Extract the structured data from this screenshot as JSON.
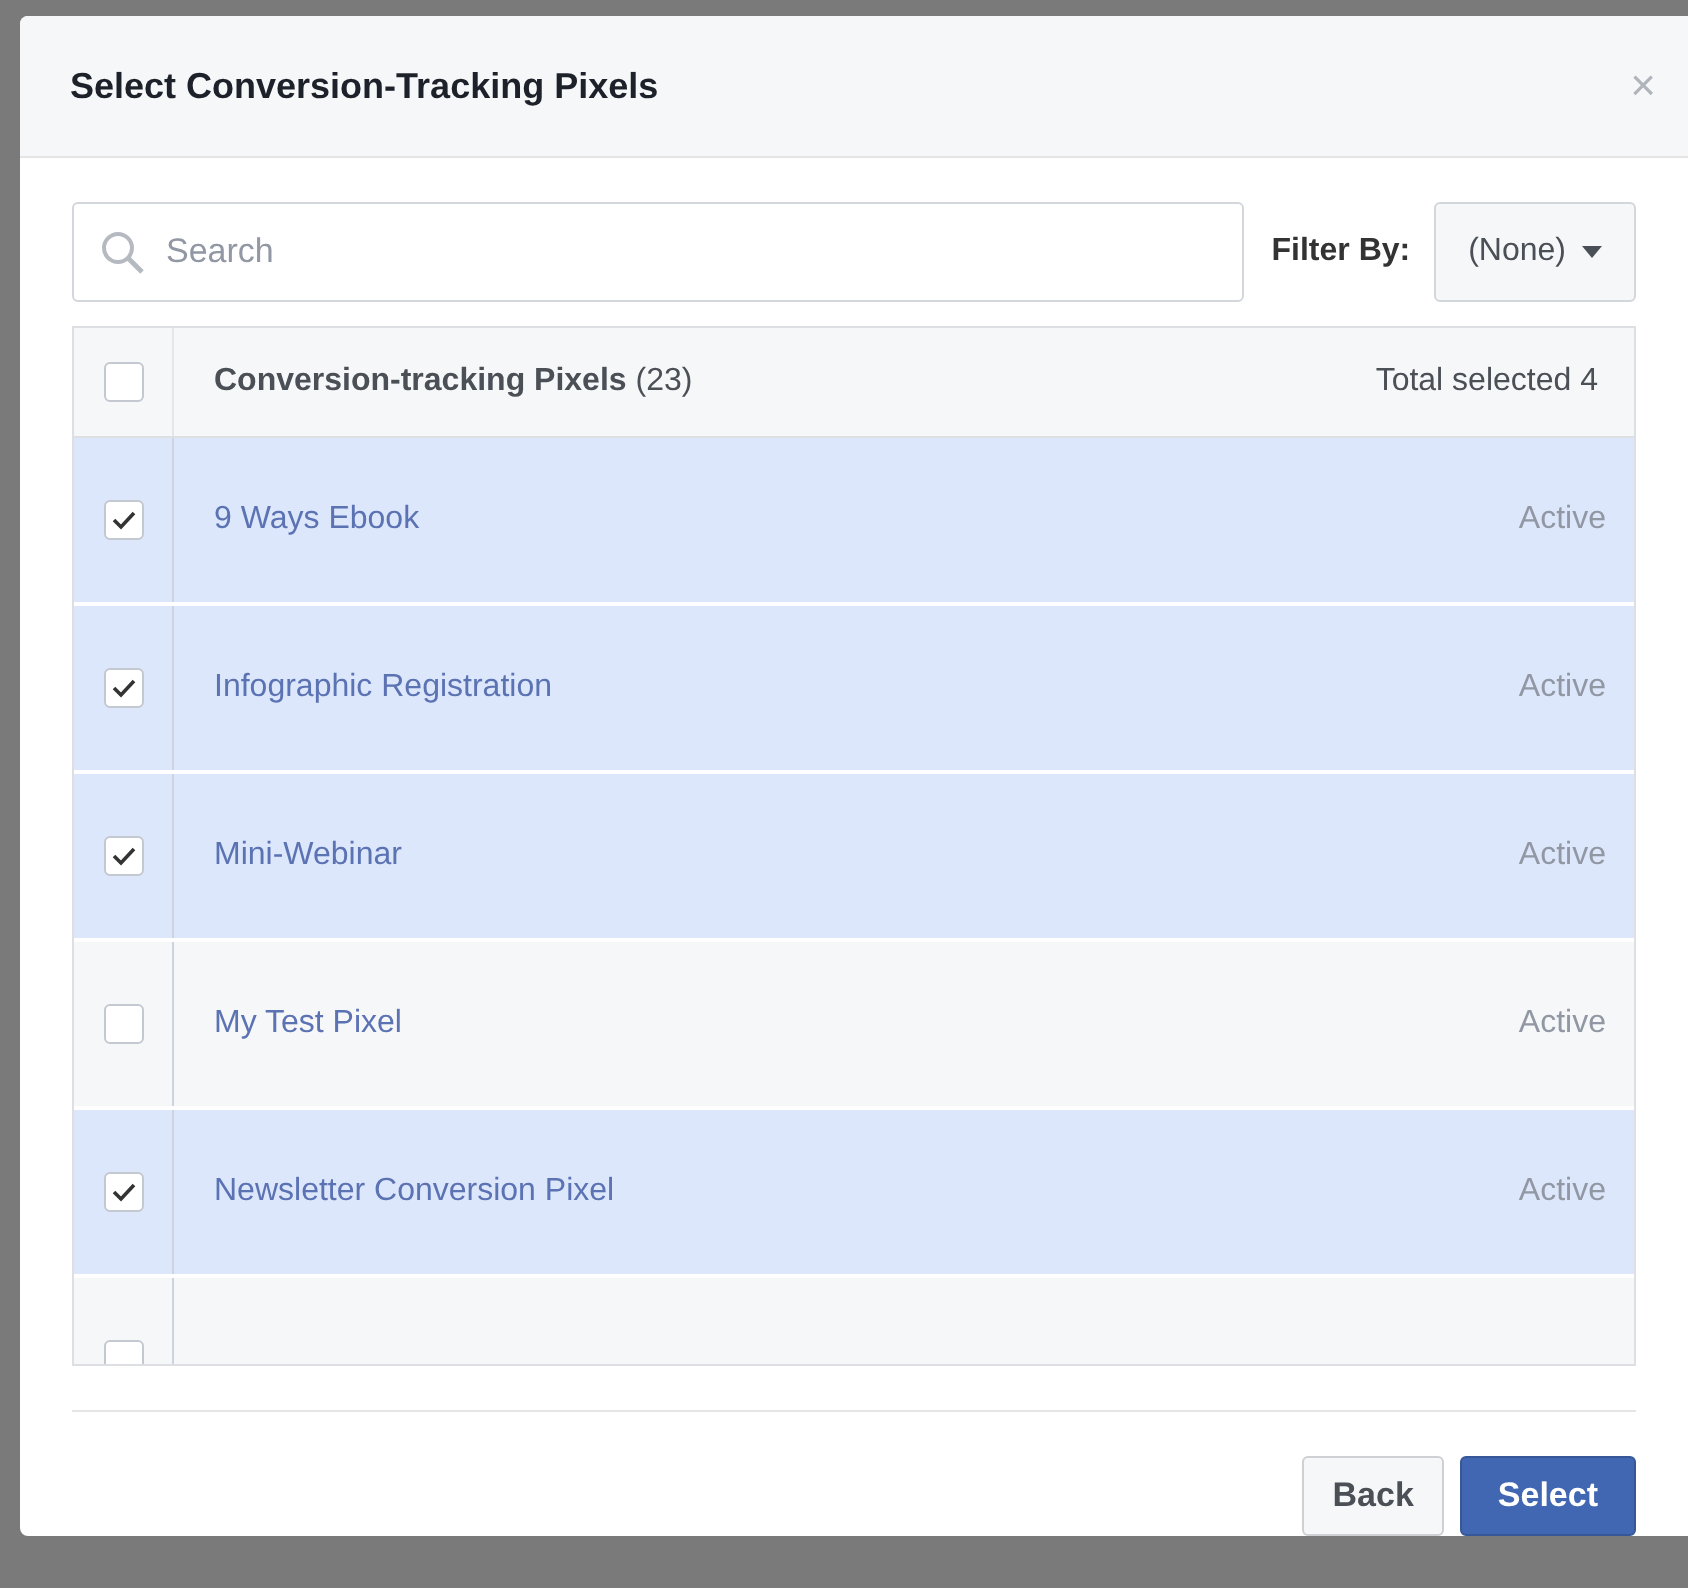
{
  "dialog": {
    "title": "Select Conversion-Tracking Pixels",
    "close": "×"
  },
  "search": {
    "placeholder": "Search"
  },
  "filter": {
    "label": "Filter By:",
    "value": "(None)"
  },
  "table": {
    "header": {
      "checked": false,
      "title": "Conversion-tracking Pixels",
      "count": "(23)",
      "total": "Total selected 4"
    },
    "rows": [
      {
        "name": "9 Ways Ebook",
        "status": "Active",
        "checked": true
      },
      {
        "name": "Infographic Registration",
        "status": "Active",
        "checked": true
      },
      {
        "name": "Mini-Webinar",
        "status": "Active",
        "checked": true
      },
      {
        "name": "My Test Pixel",
        "status": "Active",
        "checked": false
      },
      {
        "name": "Newsletter Conversion Pixel",
        "status": "Active",
        "checked": true
      },
      {
        "checked": false
      }
    ]
  },
  "buttons": [
    {
      "label": "Back",
      "kind": "secondary"
    },
    {
      "label": "Select",
      "kind": "primary"
    }
  ]
}
